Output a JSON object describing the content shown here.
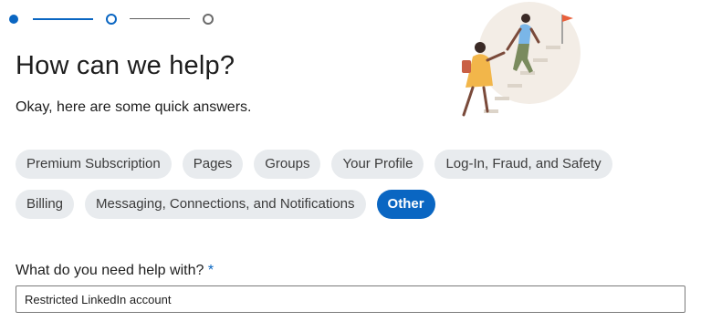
{
  "stepper": {
    "total_steps": 3,
    "current_step": 2
  },
  "header": {
    "title": "How can we help?",
    "subtitle": "Okay, here are some quick answers."
  },
  "topics": {
    "row1": [
      "Premium Subscription",
      "Pages",
      "Groups",
      "Your Profile",
      "Log-In, Fraud, and Safety"
    ],
    "row2": [
      "Billing",
      "Messaging, Connections, and Notifications",
      "Other"
    ],
    "selected": "Other"
  },
  "form": {
    "label": "What do you need help with?",
    "required_marker": "*",
    "value": "Restricted LinkedIn account"
  },
  "colors": {
    "accent": "#0a66c2",
    "chip_bg": "#e8ebee",
    "illustration_circle": "#f3ede6",
    "flag": "#e8603c"
  },
  "icons": {
    "illustration": "two-people-climbing-stairs-illustration"
  }
}
